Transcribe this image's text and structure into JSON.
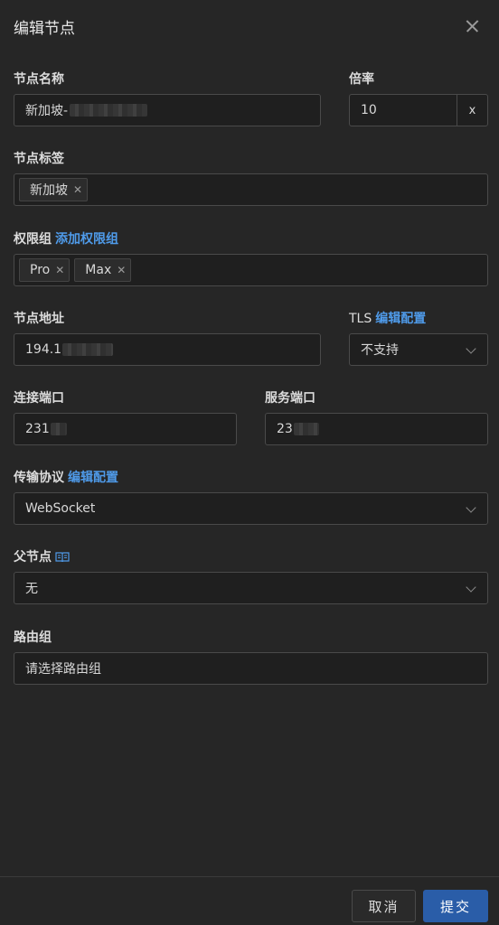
{
  "dialog": {
    "title": "编辑节点",
    "close_icon": "close-icon"
  },
  "fields": {
    "node_name": {
      "label": "节点名称",
      "value": "新加坡-"
    },
    "ratio": {
      "label": "倍率",
      "value": "10",
      "suffix": "x"
    },
    "node_tags": {
      "label": "节点标签",
      "tags": [
        "新加坡"
      ]
    },
    "permission_group": {
      "label": "权限组",
      "link": "添加权限组",
      "tags": [
        "Pro",
        "Max"
      ]
    },
    "node_address": {
      "label": "节点地址",
      "value": "194.1"
    },
    "tls": {
      "label": "TLS",
      "link": "编辑配置",
      "value": "不支持"
    },
    "connect_port": {
      "label": "连接端口",
      "value": "231"
    },
    "service_port": {
      "label": "服务端口",
      "value": "23"
    },
    "transport": {
      "label": "传输协议",
      "link": "编辑配置",
      "value": "WebSocket"
    },
    "parent_node": {
      "label": "父节点",
      "value": "无",
      "icon": "book-icon"
    },
    "route_group": {
      "label": "路由组",
      "placeholder": "请选择路由组"
    }
  },
  "footer": {
    "cancel_label": "取消",
    "submit_label": "提交"
  },
  "colors": {
    "background": "#262626",
    "link": "#4f9bea",
    "primary": "#2a5da8"
  }
}
